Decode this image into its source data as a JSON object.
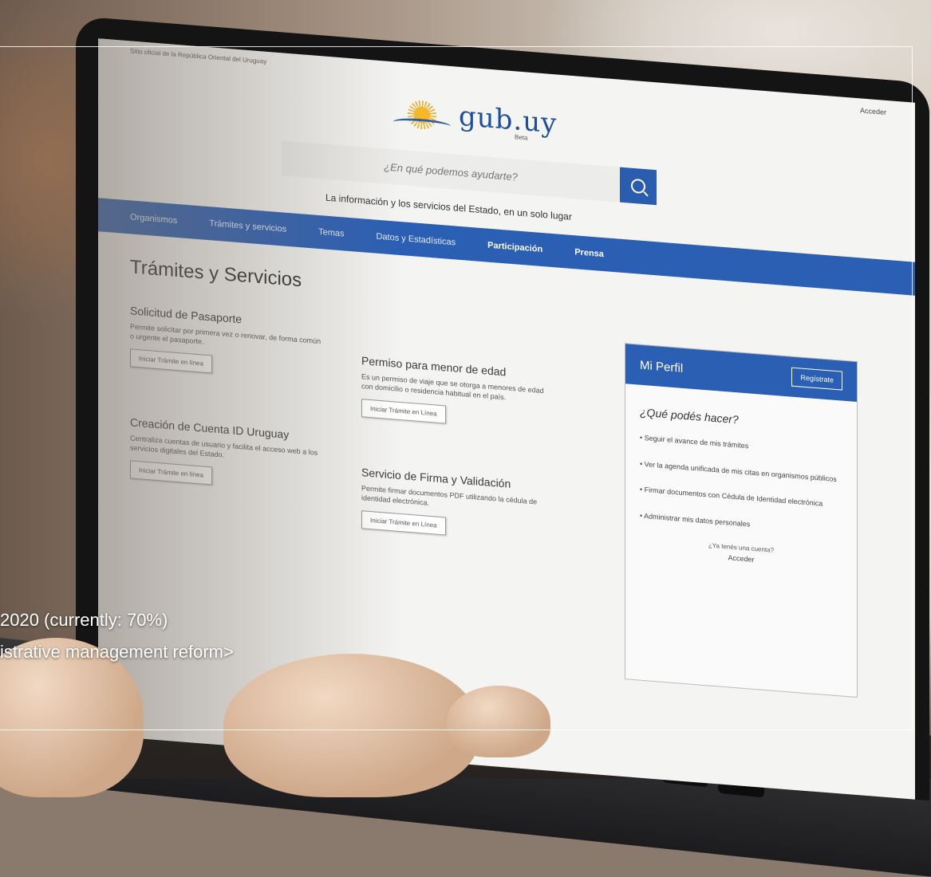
{
  "site": {
    "gov_note": "Sitio oficial de la República Oriental del Uruguay",
    "login_link": "Acceder",
    "logo_text": "gub.uy",
    "logo_badge": "Beta",
    "search_placeholder": "¿En qué podemos ayudarte?",
    "tagline": "La información y los servicios del Estado, en un solo lugar",
    "nav": [
      "Organismos",
      "Trámites y servicios",
      "Temas",
      "Datos y Estadísticas",
      "Participación",
      "Prensa"
    ],
    "section_title": "Trámites y Servicios",
    "cards": [
      {
        "title": "Solicitud de Pasaporte",
        "desc": "Permite solicitar por primera vez o renovar, de forma común o urgente el pasaporte.",
        "button": "Iniciar Trámite en línea"
      },
      {
        "title": "Creación de Cuenta ID Uruguay",
        "desc": "Centraliza cuentas de usuario y facilita el acceso web a los servicios digitales del Estado.",
        "button": "Iniciar Trámite en línea"
      },
      {
        "title": "Permiso para menor de edad",
        "desc": "Es un permiso de viaje que se otorga a menores de edad con domicilio o residencia habitual en el país.",
        "button": "Iniciar Trámite en Línea"
      },
      {
        "title": "Servicio de Firma y Validación",
        "desc": "Permite firmar documentos PDF utilizando la cédula de identidad electrónica.",
        "button": "Iniciar Trámite en Línea"
      }
    ],
    "profile": {
      "title": "Mi Perfil",
      "register": "Regístrate",
      "question": "¿Qué podés hacer?",
      "items": [
        "Seguir el avance de mis trámites",
        "Ver la agenda unificada de mis citas en organismos públicos",
        "Firmar documentos con Cédula de Identidad electrónica",
        "Administrar mis datos personales"
      ],
      "account_question": "¿Ya tenés una cuenta?",
      "login": "Acceder"
    }
  },
  "captions": {
    "line1": "2020 (currently: 70%)",
    "line2": "istrative management reform>"
  },
  "colors": {
    "brand_blue": "#2b5fb4",
    "logo_blue": "#1f4f9c",
    "sun_yellow": "#f6b72b",
    "bezel": "#141414"
  }
}
